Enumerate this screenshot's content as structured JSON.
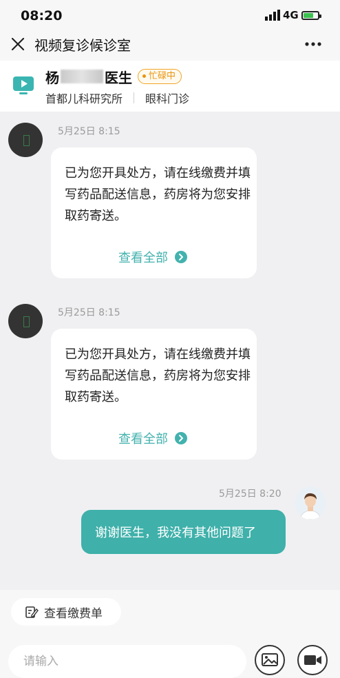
{
  "status_bar": {
    "time": "08:20",
    "network": "4G"
  },
  "nav": {
    "title": "视频复诊候诊室"
  },
  "doctor": {
    "name_first": "杨",
    "name_suffix": "医生",
    "status_badge": "忙碌中",
    "institution": "首都儿科研究所",
    "department": "眼科门诊"
  },
  "messages": [
    {
      "time": "5月25日 8:15",
      "text": "已为您开具处方，请在线缴费并填写药品配送信息，药房将为您安排取药寄送。",
      "link": "查看全部"
    },
    {
      "time": "5月25日 8:15",
      "text": "已为您开具处方，请在线缴费并填写药品配送信息，药房将为您安排取药寄送。",
      "link": "查看全部"
    }
  ],
  "user_message": {
    "time": "5月25日 8:20",
    "text": "谢谢医生，我没有其他问题了"
  },
  "bottom": {
    "bill_button": "查看缴费单",
    "input_placeholder": "请输入"
  },
  "colors": {
    "accent": "#3fb0aa",
    "badge": "#e8950f"
  }
}
